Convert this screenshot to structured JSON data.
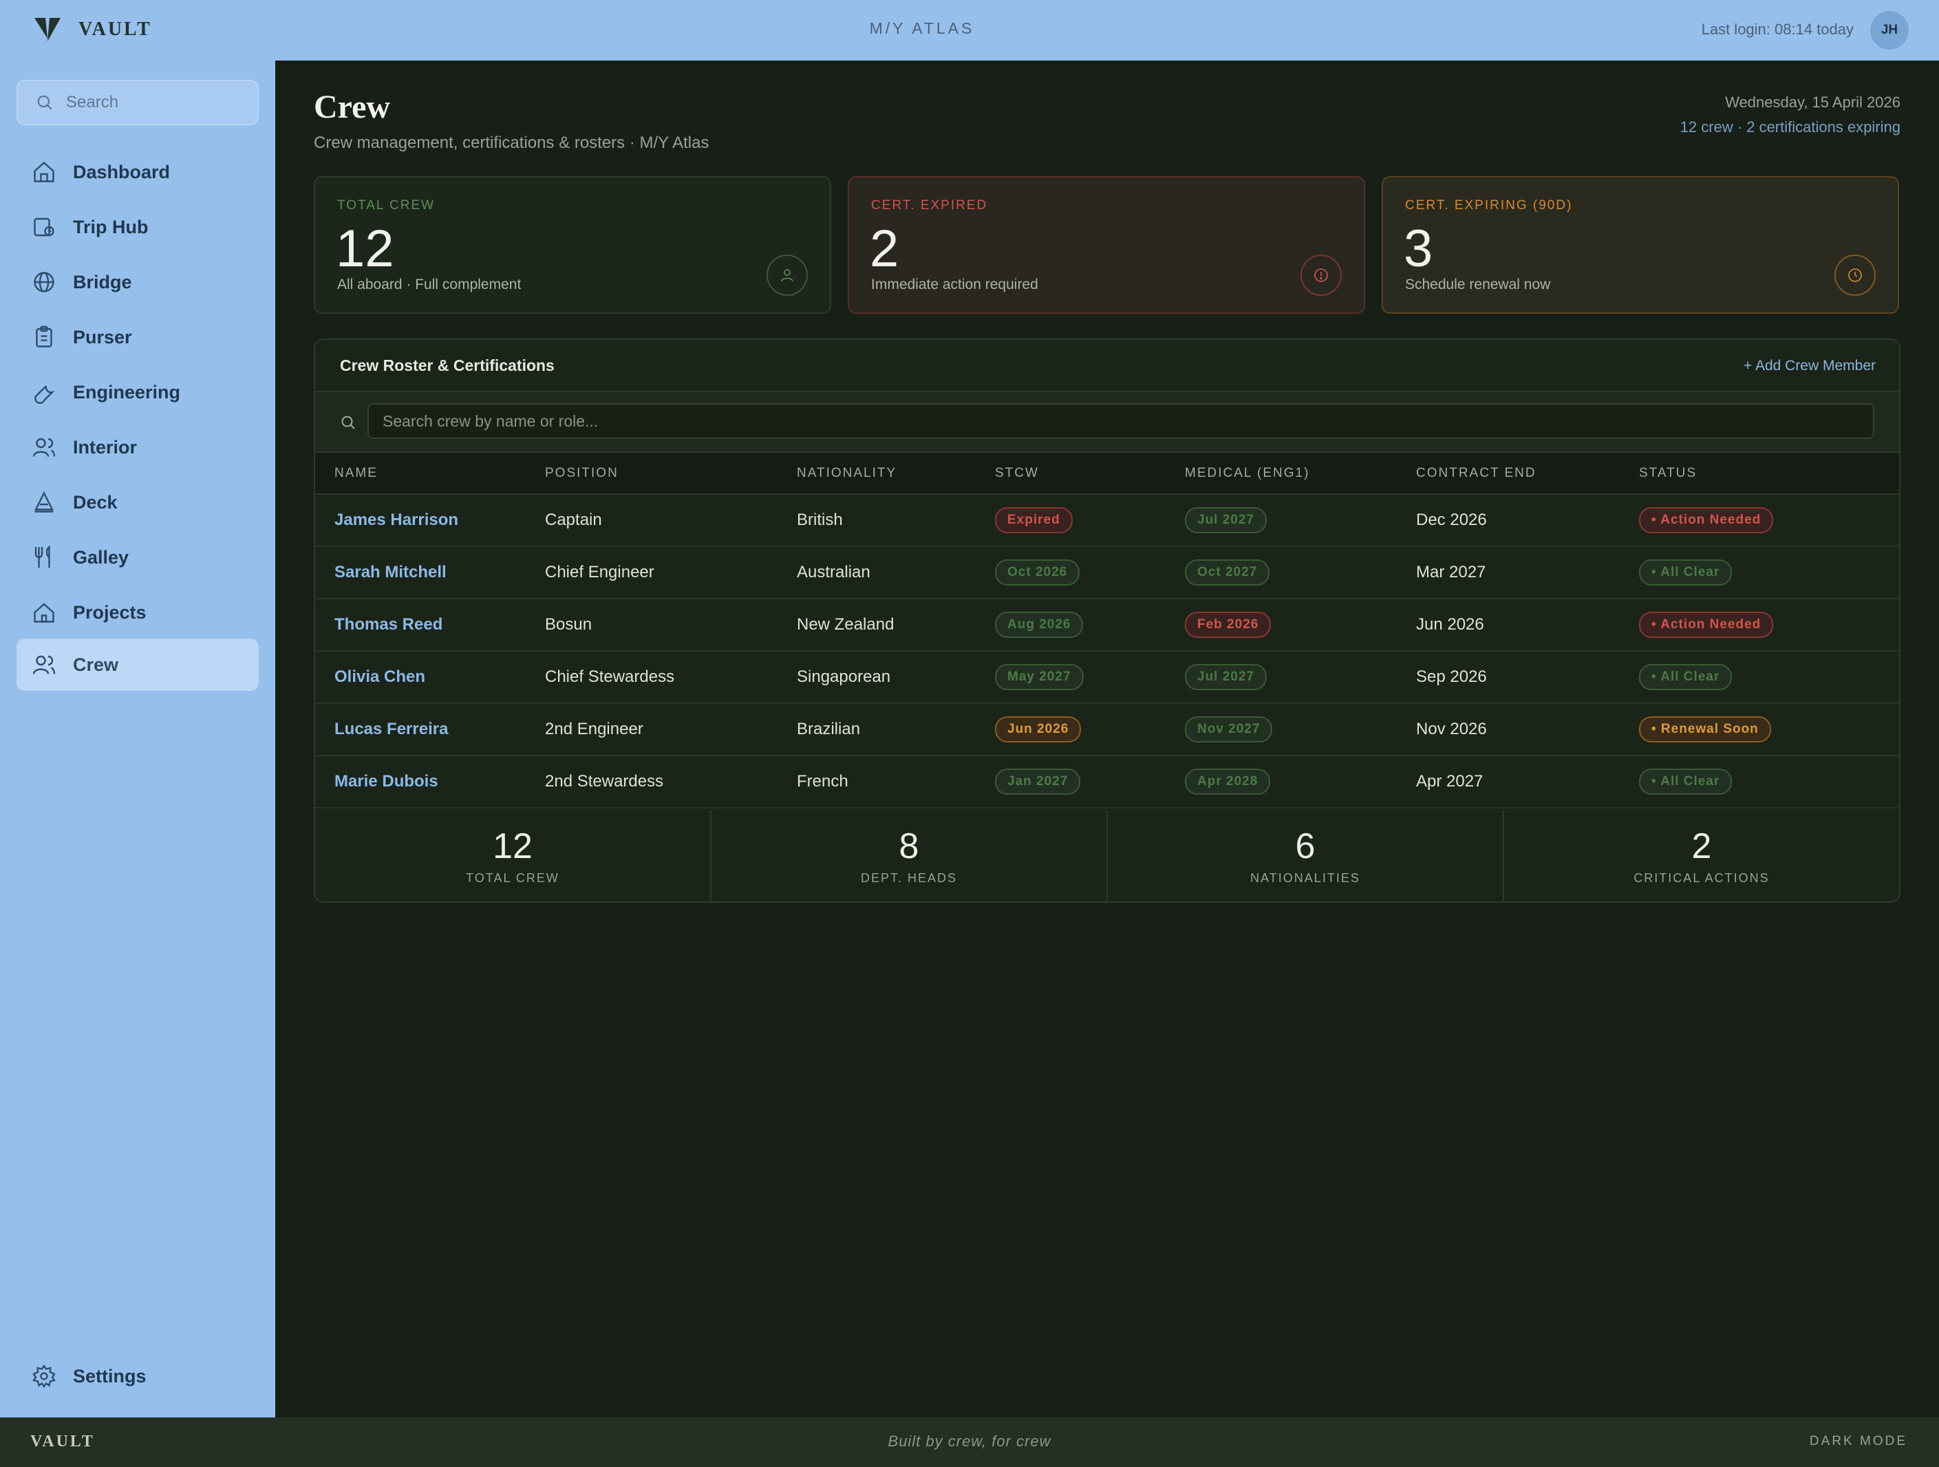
{
  "topbar": {
    "brand": "VAULT",
    "vessel": "M/Y ATLAS",
    "last_login": "Last login: 08:14 today",
    "avatar_initials": "JH"
  },
  "sidebar": {
    "search_placeholder": "Search",
    "items": [
      {
        "label": "Dashboard",
        "icon": "home-icon"
      },
      {
        "label": "Trip Hub",
        "icon": "trip-icon"
      },
      {
        "label": "Bridge",
        "icon": "globe-icon"
      },
      {
        "label": "Purser",
        "icon": "clipboard-icon"
      },
      {
        "label": "Engineering",
        "icon": "wrench-icon"
      },
      {
        "label": "Interior",
        "icon": "users-icon"
      },
      {
        "label": "Deck",
        "icon": "triangle-icon"
      },
      {
        "label": "Galley",
        "icon": "utensils-icon"
      },
      {
        "label": "Projects",
        "icon": "house-icon"
      },
      {
        "label": "Crew",
        "icon": "crew-icon",
        "active": true
      }
    ],
    "settings_label": "Settings"
  },
  "header": {
    "title": "Crew",
    "subtitle": "Crew management, certifications & rosters · M/Y Atlas",
    "date": "Wednesday, 15 April 2026",
    "summary": "12 crew · 2 certifications expiring"
  },
  "cards": [
    {
      "label": "TOTAL CREW",
      "value": "12",
      "note": "All aboard · Full complement",
      "color": "#5f8f58",
      "icon": "person-icon"
    },
    {
      "label": "CERT. EXPIRED",
      "value": "2",
      "note": "Immediate action required",
      "color": "#d0564b",
      "icon": "alert-icon"
    },
    {
      "label": "CERT. EXPIRING (90D)",
      "value": "3",
      "note": "Schedule renewal now",
      "color": "#d68a35",
      "icon": "clock-icon"
    }
  ],
  "roster": {
    "title": "Crew Roster & Certifications",
    "add_label": "+ Add Crew Member",
    "search_placeholder": "Search crew by name or role...",
    "columns": [
      "NAME",
      "POSITION",
      "NATIONALITY",
      "STCW",
      "MEDICAL (ENG1)",
      "CONTRACT END",
      "STATUS"
    ],
    "rows": [
      {
        "name": "James Harrison",
        "position": "Captain",
        "nationality": "British",
        "stcw": "Expired",
        "stcw_state": "exp",
        "medical": "Jul 2027",
        "medical_state": "ok",
        "contract": "Dec 2026",
        "status": "• Action Needed",
        "status_state": "exp"
      },
      {
        "name": "Sarah Mitchell",
        "position": "Chief Engineer",
        "nationality": "Australian",
        "stcw": "Oct 2026",
        "stcw_state": "ok",
        "medical": "Oct 2027",
        "medical_state": "ok",
        "contract": "Mar 2027",
        "status": "• All Clear",
        "status_state": "ok"
      },
      {
        "name": "Thomas Reed",
        "position": "Bosun",
        "nationality": "New Zealand",
        "stcw": "Aug 2026",
        "stcw_state": "ok",
        "medical": "Feb 2026",
        "medical_state": "exp",
        "contract": "Jun 2026",
        "status": "• Action Needed",
        "status_state": "exp"
      },
      {
        "name": "Olivia Chen",
        "position": "Chief Stewardess",
        "nationality": "Singaporean",
        "stcw": "May 2027",
        "stcw_state": "ok",
        "medical": "Jul 2027",
        "medical_state": "ok",
        "contract": "Sep 2026",
        "status": "• All Clear",
        "status_state": "ok"
      },
      {
        "name": "Lucas Ferreira",
        "position": "2nd Engineer",
        "nationality": "Brazilian",
        "stcw": "Jun 2026",
        "stcw_state": "warn",
        "medical": "Nov 2027",
        "medical_state": "ok",
        "contract": "Nov 2026",
        "status": "• Renewal Soon",
        "status_state": "warn"
      },
      {
        "name": "Marie Dubois",
        "position": "2nd Stewardess",
        "nationality": "French",
        "stcw": "Jan 2027",
        "stcw_state": "ok",
        "medical": "Apr 2028",
        "medical_state": "ok",
        "contract": "Apr 2027",
        "status": "• All Clear",
        "status_state": "ok"
      }
    ],
    "summary": [
      {
        "value": "12",
        "label": "TOTAL CREW"
      },
      {
        "value": "8",
        "label": "DEPT. HEADS"
      },
      {
        "value": "6",
        "label": "NATIONALITIES"
      },
      {
        "value": "2",
        "label": "CRITICAL ACTIONS"
      }
    ]
  },
  "footer": {
    "brand": "VAULT",
    "tagline": "Built by crew, for crew",
    "mode": "DARK MODE"
  }
}
